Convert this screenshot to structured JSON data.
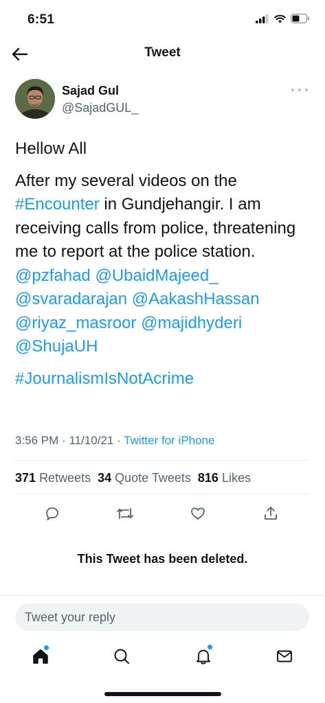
{
  "status_bar": {
    "time": "6:51"
  },
  "nav": {
    "title": "Tweet"
  },
  "author": {
    "name": "Sajad Gul",
    "handle": "@SajadGUL_"
  },
  "tweet": {
    "greeting": "Hellow All",
    "body_before": "After my several videos on the ",
    "hashtag_encounter": "#Encounter",
    "body_after": " in Gundjehangir. I am receiving calls from police, threatening me to report at the police station.",
    "mentions": [
      "@pzfahad",
      "@UbaidMajeed_",
      "@svaradarajan",
      "@AakashHassan",
      "@riyaz_masroor",
      "@majidhyderi",
      "@ShujaUH"
    ],
    "hashtag_journalism": "#JournalismIsNotAcrime"
  },
  "meta": {
    "time": "3:56 PM",
    "separator": "·",
    "date": "11/10/21",
    "source": "Twitter for iPhone"
  },
  "stats": {
    "retweets_count": "371",
    "retweets_label": "Retweets",
    "quotes_count": "34",
    "quotes_label": "Quote Tweets",
    "likes_count": "816",
    "likes_label": "Likes"
  },
  "actions": [
    "reply-icon",
    "retweet-icon",
    "like-icon",
    "share-icon"
  ],
  "deleted_notice": "This Tweet has been deleted.",
  "reply": {
    "placeholder": "Tweet your reply"
  },
  "tabbar": {
    "items": [
      "home-icon",
      "search-icon",
      "notifications-icon",
      "messages-icon"
    ],
    "badges": [
      "home",
      "notifications"
    ]
  },
  "colors": {
    "accent": "#1d9bf0",
    "text": "#0f1419",
    "secondary": "#536471",
    "divider": "#e6ecf0",
    "input_bg": "#eff3f4"
  }
}
